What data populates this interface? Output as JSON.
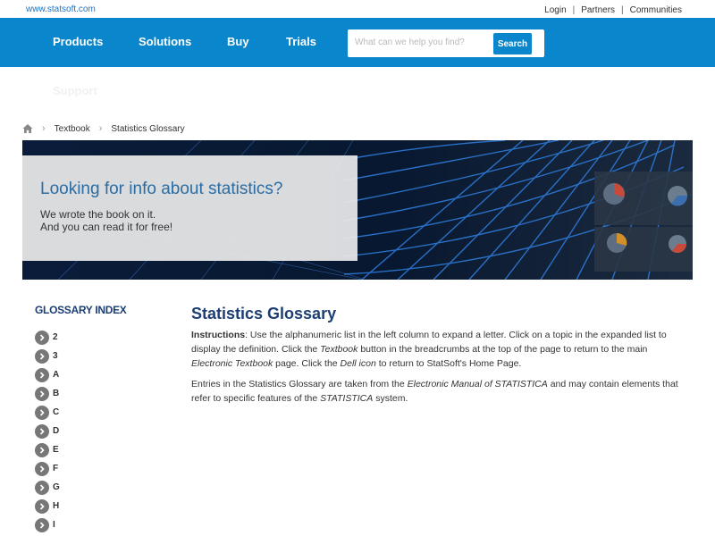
{
  "topbar": {
    "site_url": "www.statsoft.com",
    "links": [
      "Login",
      "Partners",
      "Communities"
    ],
    "separator": "|"
  },
  "nav": {
    "items": [
      "Products",
      "Solutions",
      "Buy",
      "Trials"
    ],
    "support": "Support",
    "search_placeholder": "What can we help you find?",
    "search_button": "Search"
  },
  "breadcrumb": {
    "home_icon": "home-icon",
    "items": [
      "Textbook",
      "Statistics Glossary"
    ]
  },
  "hero": {
    "title": "Looking for info about statistics?",
    "line1": "We wrote the book on it.",
    "line2": "And you can read it for free!"
  },
  "glossary_index": {
    "title": "GLOSSARY INDEX",
    "items": [
      "2",
      "3",
      "A",
      "B",
      "C",
      "D",
      "E",
      "F",
      "G",
      "H",
      "I"
    ]
  },
  "main": {
    "title": "Statistics Glossary",
    "instructions": {
      "label": "Instructions",
      "t1": ": Use the alphanumeric list in the left column to expand a letter. Click on a topic in the expanded list to display the definition. Click the ",
      "e1": "Textbook",
      "t2": " button in the breadcrumbs at the top of the page to return to the main ",
      "e2": "Electronic Textbook",
      "t3": " page. Click the ",
      "e3": "Dell icon",
      "t4": " to return to StatSoft's Home Page."
    },
    "entries": {
      "t1": "Entries in the Statistics Glossary are taken from the ",
      "e1": "Electronic Manual of STATISTICA",
      "t2": " and may contain elements that refer to specific features of the ",
      "e2": "STATISTICA",
      "t3": " system."
    }
  },
  "colors": {
    "nav_bg": "#0a86cc",
    "heading": "#1c3e73",
    "hero_text": "#2b6da3"
  }
}
